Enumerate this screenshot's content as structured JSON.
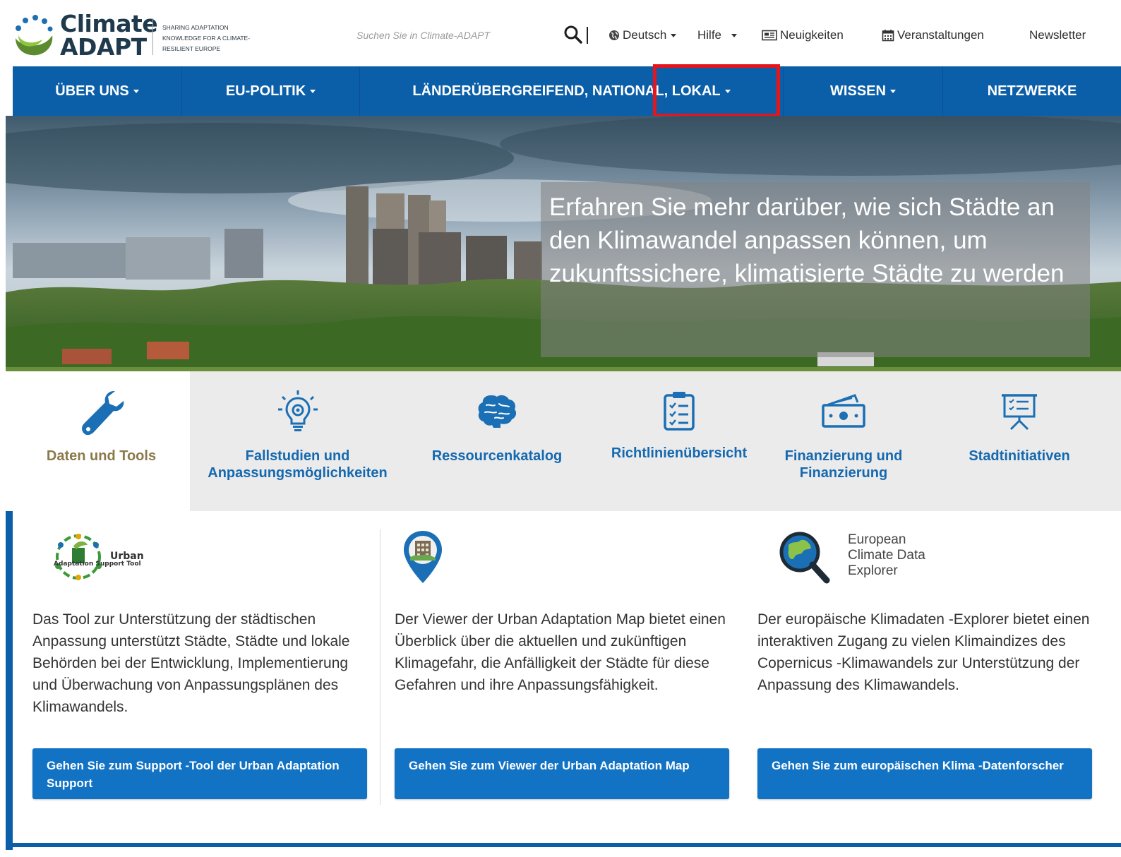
{
  "header": {
    "logo_line1": "Climate",
    "logo_line2": "ADAPT",
    "tagline": "SHARING ADAPTATION KNOWLEDGE FOR A CLIMATE-RESILIENT EUROPE",
    "search_placeholder": "Suchen Sie in Climate-ADAPT",
    "language": "Deutsch",
    "help": "Hilfe",
    "news": "Neuigkeiten",
    "events": "Veranstaltungen",
    "newsletter": "Newsletter"
  },
  "nav": {
    "items": [
      {
        "label": "ÜBER UNS"
      },
      {
        "label": "EU-POLITIK"
      },
      {
        "label": "LÄNDERÜBERGREIFEND, NATIONAL, LOKAL"
      },
      {
        "label": "WISSEN"
      },
      {
        "label": "NETZWERKE"
      }
    ]
  },
  "hero": {
    "caption": "Erfahren Sie mehr darüber, wie sich Städte an den Klimawandel anpassen können, um zukunftssichere, klimatisierte Städte zu werden"
  },
  "tabs": [
    {
      "label": "Daten und Tools",
      "icon": "wrench-icon",
      "active": true
    },
    {
      "label": "Fallstudien und Anpassungsmöglichkeiten",
      "icon": "lightbulb-gear-icon"
    },
    {
      "label": "Ressourcenkatalog",
      "icon": "brain-icon"
    },
    {
      "label": "Richtlinienübersicht",
      "icon": "clipboard-list-icon"
    },
    {
      "label": "Finanzierung und Finanzierung",
      "icon": "money-icon"
    },
    {
      "label": "Stadtinitiativen",
      "icon": "presentation-board-icon"
    }
  ],
  "content": {
    "col1": {
      "logo_text": "Urban",
      "logo_subtext": "Adaptation Support Tool",
      "desc": "Das Tool zur Unterstützung der städtischen Anpassung unterstützt Städte, Städte und lokale Behörden bei der Entwicklung, Implementierung und Überwachung von Anpassungsplänen des Klimawandels.",
      "button": "Gehen Sie zum Support -Tool der Urban Adaptation Support"
    },
    "col2": {
      "desc": "Der Viewer der Urban Adaptation Map bietet einen Überblick über die aktuellen und zukünftigen Klimagefahr, die Anfälligkeit der Städte für diese Gefahren und ihre Anpassungsfähigkeit.",
      "button": "Gehen Sie zum Viewer der Urban Adaptation Map"
    },
    "col3": {
      "logo_line1": "European",
      "logo_line2": "Climate Data",
      "logo_line3": "Explorer",
      "desc": "Der europäische Klimadaten -Explorer bietet einen interaktiven Zugang zu vielen Klimaindizes des Copernicus -Klimawandels zur Unterstützung der Anpassung des Klimawandels.",
      "button": "Gehen Sie zum europäischen Klima -Datenforscher"
    }
  },
  "colors": {
    "brand_blue": "#0b5ea8",
    "button_blue": "#1272c4",
    "highlight_red": "#e8141c",
    "active_tab_text": "#8a7a4a"
  }
}
